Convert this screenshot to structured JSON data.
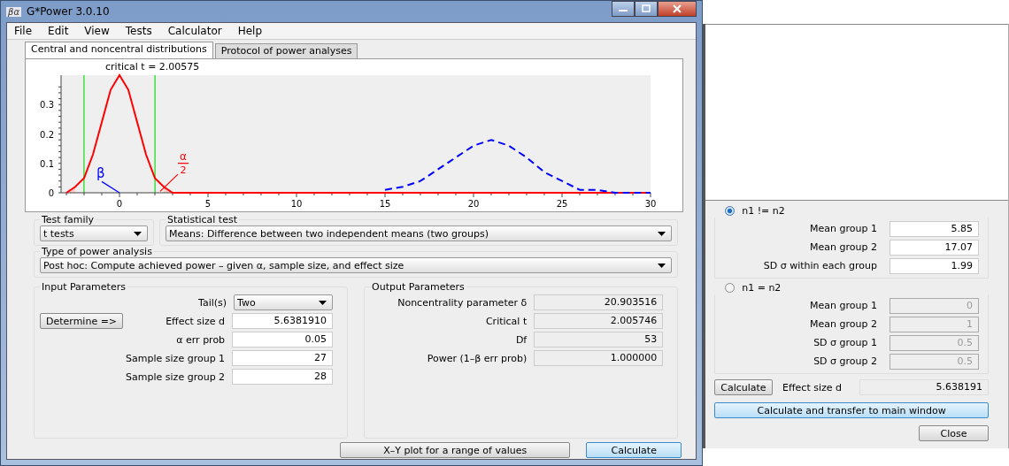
{
  "window": {
    "title": "G*Power 3.0.10",
    "icon_text": "βα"
  },
  "menu": [
    "File",
    "Edit",
    "View",
    "Tests",
    "Calculator",
    "Help"
  ],
  "tabs": [
    {
      "label": "Central and noncentral distributions",
      "selected": true
    },
    {
      "label": "Protocol of power analyses",
      "selected": false
    }
  ],
  "plot": {
    "chart_data": {
      "type": "line",
      "title": "critical t = 2.00575",
      "x": [
        -3,
        -2.5,
        -2,
        -1.5,
        -1,
        -0.5,
        0,
        0.5,
        1,
        1.5,
        2,
        2.5,
        3,
        3.5,
        4,
        5,
        6,
        7,
        8,
        9,
        10,
        11,
        12,
        13,
        14,
        15,
        16,
        17,
        18,
        19,
        20,
        21,
        22,
        23,
        24,
        25,
        26,
        27,
        28,
        29,
        30
      ],
      "series": [
        {
          "color": "#ff0000",
          "line_style": "solid",
          "values": [
            0,
            0.02,
            0.05,
            0.13,
            0.24,
            0.35,
            0.4,
            0.35,
            0.24,
            0.13,
            0.05,
            0.02,
            0,
            0,
            0,
            0,
            0,
            0,
            0,
            0,
            0,
            0,
            0,
            0,
            0,
            0,
            0,
            0,
            0,
            0,
            0,
            0,
            0,
            0,
            0,
            0,
            0,
            0,
            0,
            0,
            0
          ]
        },
        {
          "color": "#0000ff",
          "line_style": "dashed",
          "values": [
            null,
            null,
            null,
            null,
            null,
            null,
            null,
            null,
            null,
            null,
            null,
            null,
            null,
            null,
            null,
            null,
            null,
            null,
            null,
            null,
            null,
            null,
            null,
            null,
            null,
            0.01,
            0.02,
            0.04,
            0.08,
            0.12,
            0.16,
            0.18,
            0.16,
            0.12,
            0.07,
            0.04,
            0.01,
            0.01,
            0,
            0,
            0
          ]
        }
      ],
      "xlim": [
        -3.3,
        30
      ],
      "ylim": [
        0,
        0.4
      ],
      "xticks": [
        0,
        5,
        10,
        15,
        20,
        25,
        30
      ],
      "yticks": [
        0,
        0.1,
        0.2,
        0.3
      ],
      "ref_lines": [
        {
          "axis": "x",
          "value": -2.00575,
          "color": "#22dd22"
        },
        {
          "axis": "x",
          "value": 2.00575,
          "color": "#22dd22"
        }
      ],
      "annotations": [
        "β",
        "α",
        "2"
      ]
    }
  },
  "test_family": {
    "label": "Test family",
    "value": "t tests"
  },
  "statistical_test": {
    "label": "Statistical test",
    "value": "Means: Difference between two independent means (two groups)"
  },
  "power_analysis_type": {
    "label": "Type of power analysis",
    "value": "Post hoc: Compute achieved power – given α, sample size, and effect size"
  },
  "input_parameters": {
    "title": "Input Parameters",
    "determine_button": "Determine =>",
    "fields": [
      {
        "kind": "dropdown",
        "label": "Tail(s)",
        "value": "Two"
      },
      {
        "kind": "input",
        "label": "Effect size d",
        "value": "5.6381910"
      },
      {
        "kind": "input",
        "label": "α err prob",
        "value": "0.05"
      },
      {
        "kind": "input",
        "label": "Sample size group 1",
        "value": "27"
      },
      {
        "kind": "input",
        "label": "Sample size group 2",
        "value": "28"
      }
    ]
  },
  "output_parameters": {
    "title": "Output Parameters",
    "fields": [
      {
        "label": "Noncentrality parameter δ",
        "value": "20.903516"
      },
      {
        "label": "Critical t",
        "value": "2.005746"
      },
      {
        "label": "Df",
        "value": "53"
      },
      {
        "label": "Power (1–β err prob)",
        "value": "1.000000"
      }
    ]
  },
  "buttons": [
    {
      "label": "X–Y plot for a range of values",
      "default": false
    },
    {
      "label": "Calculate",
      "default": true
    }
  ],
  "effect_size_panel": {
    "groups": [
      {
        "label": "n1 != n2",
        "selected": true,
        "fields": [
          {
            "label": "Mean group 1",
            "value": "5.85"
          },
          {
            "label": "Mean group 2",
            "value": "17.07"
          },
          {
            "label": "SD σ within each group",
            "value": "1.99"
          }
        ]
      },
      {
        "label": "n1 = n2",
        "selected": false,
        "fields": [
          {
            "label": "Mean group 1",
            "value": "0"
          },
          {
            "label": "Mean group 2",
            "value": "1"
          },
          {
            "label": "SD σ group 1",
            "value": "0.5"
          },
          {
            "label": "SD σ group 2",
            "value": "0.5"
          }
        ]
      }
    ],
    "calculate_button": "Calculate",
    "effect_size_label": "Effect size d",
    "effect_size_value": "5.638191",
    "transfer_button": "Calculate and transfer to main window",
    "close_button": "Close"
  }
}
